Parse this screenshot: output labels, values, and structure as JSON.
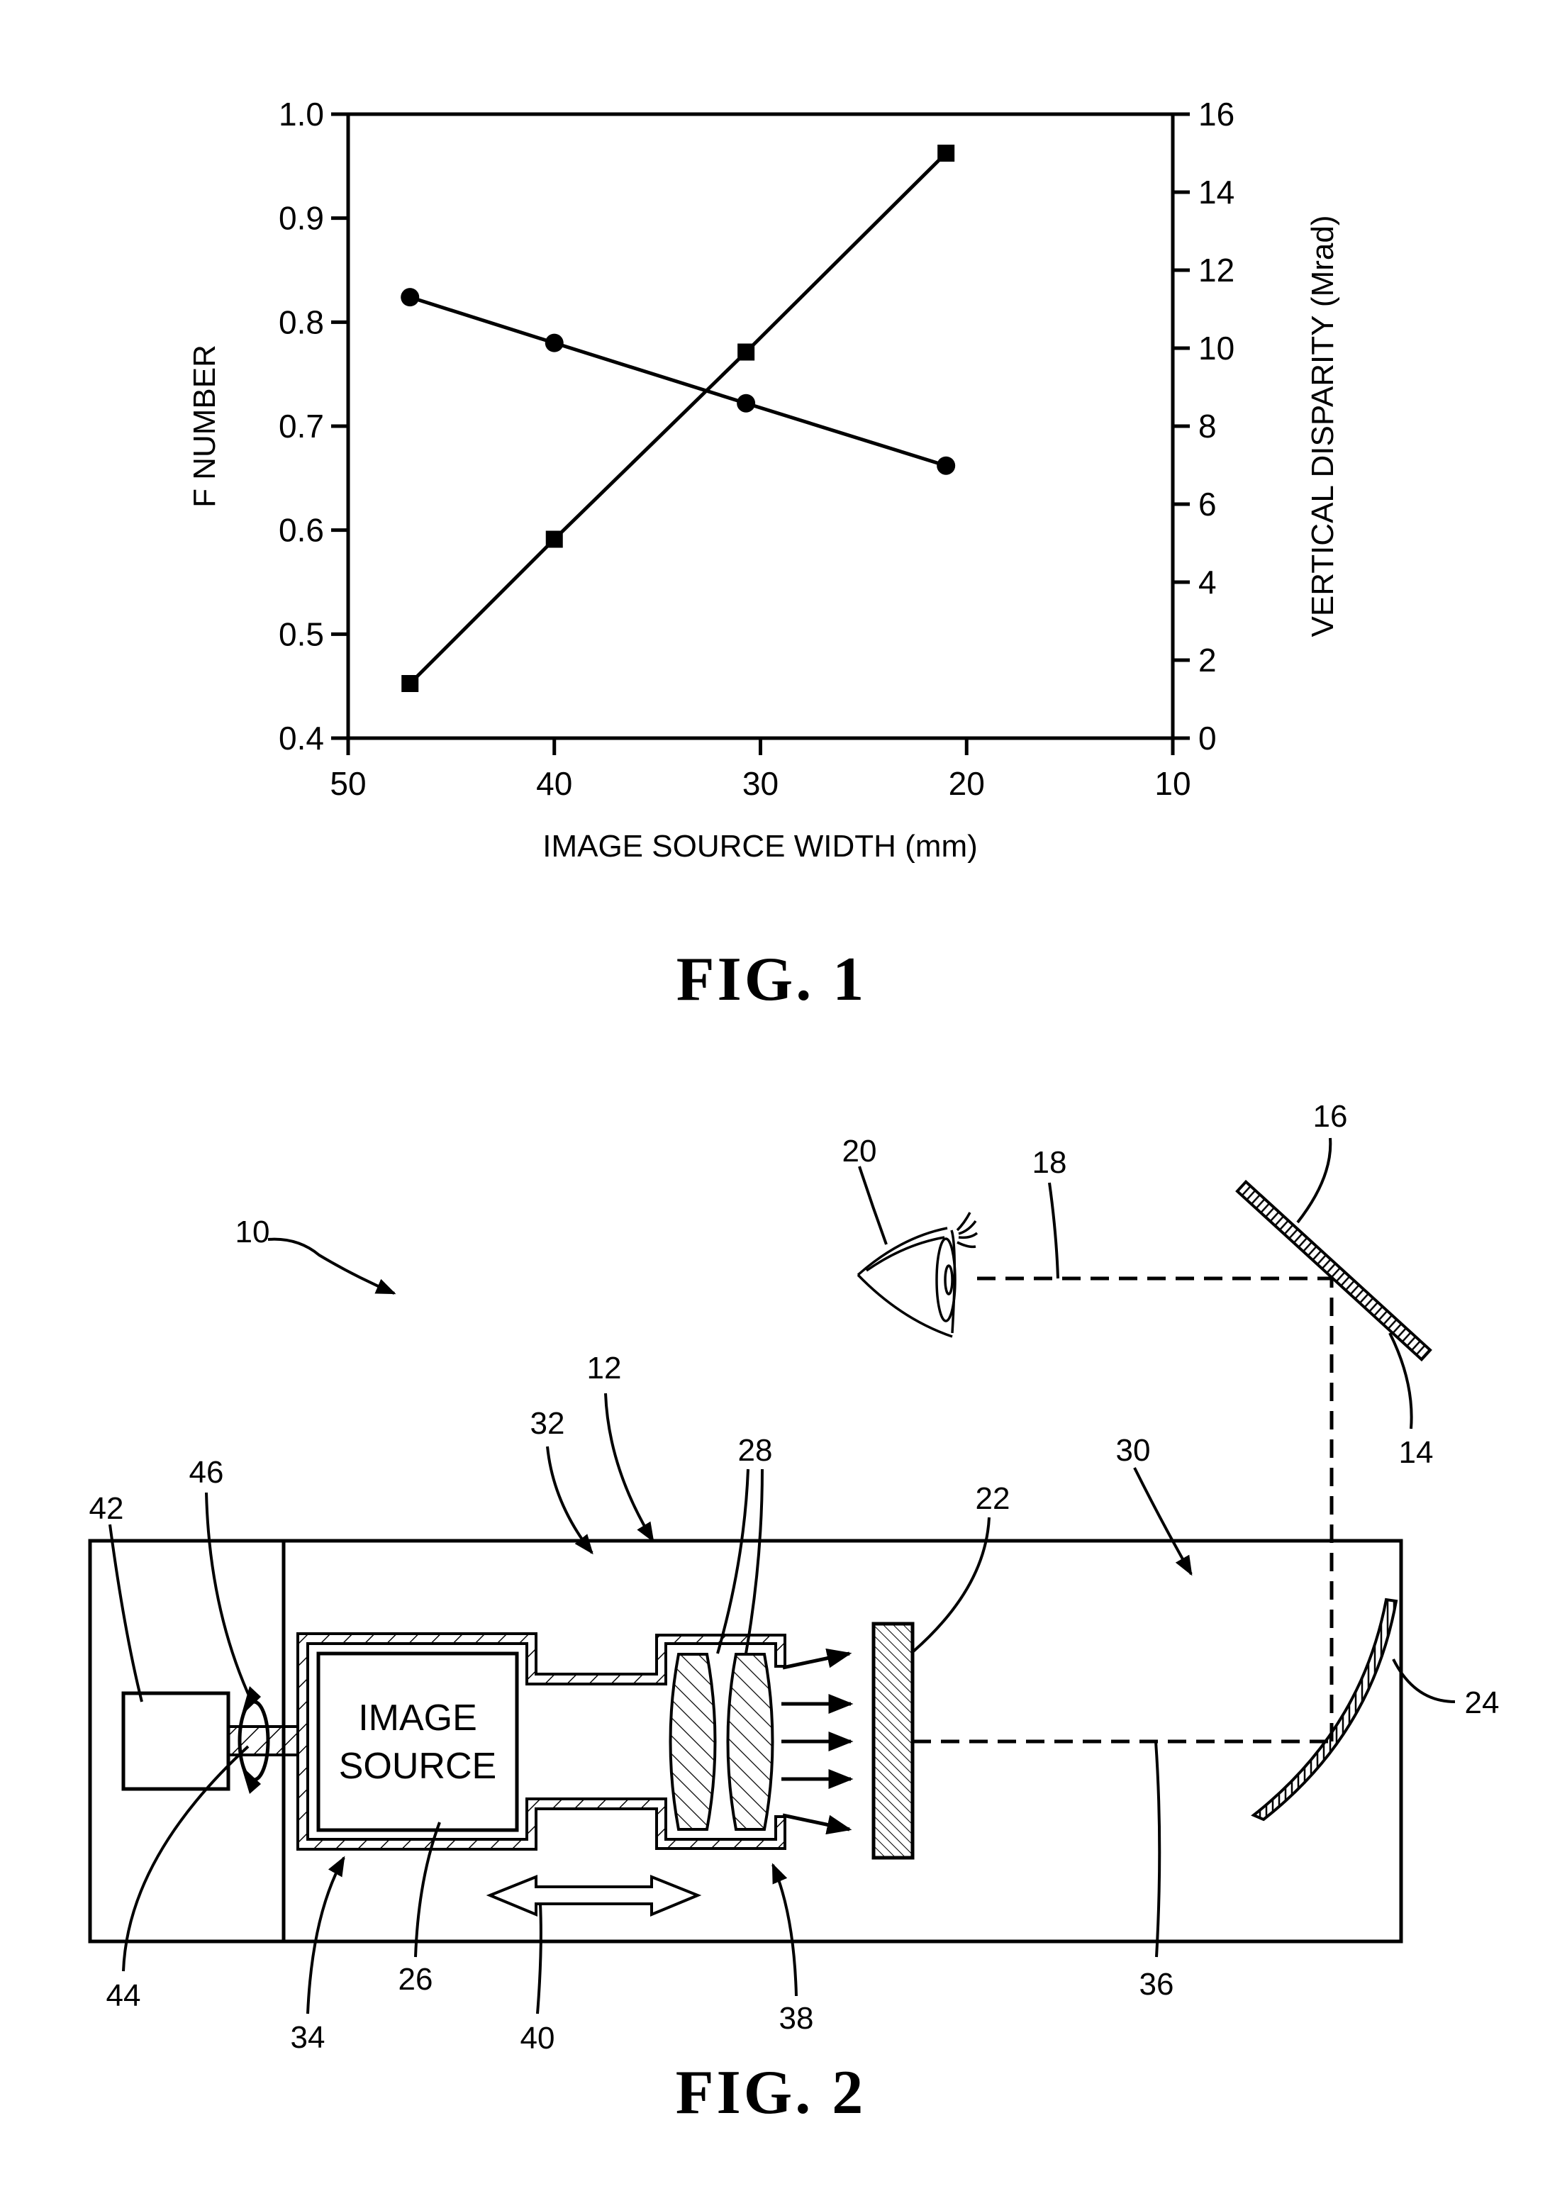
{
  "chart_data": {
    "type": "line",
    "figure_label": "FIG. 1",
    "title": "",
    "xlabel": "IMAGE SOURCE WIDTH (mm)",
    "ylabel": "F NUMBER",
    "y2label": "VERTICAL DISPARITY (Mrad)",
    "xlim": [
      50,
      10
    ],
    "ylim": [
      0.4,
      1.0
    ],
    "y2lim": [
      0,
      16
    ],
    "x_ticks": [
      "50",
      "40",
      "30",
      "20",
      "10"
    ],
    "y_ticks": [
      "0.4",
      "0.5",
      "0.6",
      "0.7",
      "0.8",
      "0.9",
      "1.0"
    ],
    "y2_ticks": [
      "0",
      "2",
      "4",
      "6",
      "8",
      "10",
      "12",
      "14",
      "16"
    ],
    "grid": false,
    "legend": "none",
    "series": [
      {
        "name": "F NUMBER",
        "axis": "left",
        "marker": "circle",
        "x": [
          47,
          40,
          30.7,
          21
        ],
        "values": [
          0.824,
          0.78,
          0.722,
          0.662
        ]
      },
      {
        "name": "VERTICAL DISPARITY (Mrad)",
        "axis": "right",
        "marker": "square",
        "x": [
          47,
          40,
          30.7,
          21
        ],
        "values": [
          1.4,
          5.1,
          9.9,
          15.0
        ]
      }
    ]
  },
  "fig2": {
    "figure_label": "FIG. 2",
    "image_source_text": [
      "IMAGE",
      "SOURCE"
    ],
    "reference_numerals": {
      "system": "10",
      "housing": "12",
      "combiner_surface": "14",
      "combiner": "16",
      "line_of_sight": "18",
      "eye": "20",
      "screen": "22",
      "mirror": "24",
      "image_source": "26",
      "lenses": "28",
      "chamber_right": "30",
      "chamber_left": "32",
      "image_source_housing": "34",
      "optical_path": "36",
      "lens_housing": "38",
      "movement_arrow": "40",
      "actuator": "42",
      "shaft": "44",
      "rotation": "46"
    }
  }
}
